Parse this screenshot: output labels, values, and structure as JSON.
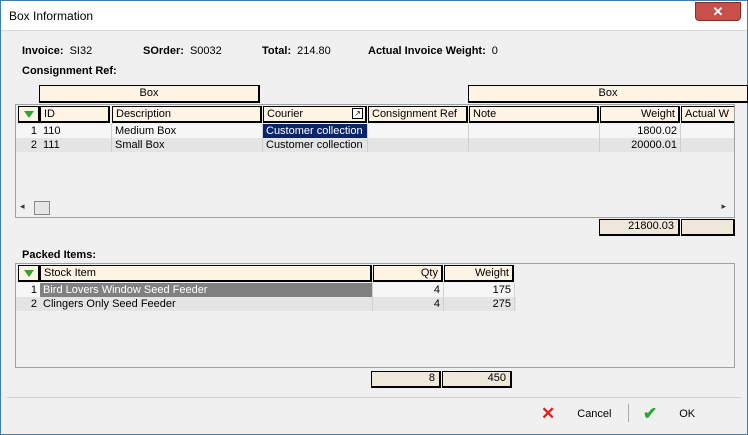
{
  "window": {
    "title": "Box Information"
  },
  "info": {
    "invoice_label": "Invoice:",
    "invoice_value": "SI32",
    "sorder_label": "SOrder:",
    "sorder_value": "S0032",
    "total_label": "Total:",
    "total_value": "214.80",
    "weight_label": "Actual Invoice Weight:",
    "weight_value": "0"
  },
  "consignment_label": "Consignment Ref:",
  "boxes": {
    "group_left": "Box",
    "group_right": "Box",
    "columns": {
      "id": "ID",
      "description": "Description",
      "courier": "Courier",
      "consignment_ref": "Consignment Ref",
      "note": "Note",
      "weight": "Weight",
      "actual_weight": "Actual W"
    },
    "rows": [
      {
        "num": "1",
        "id": "110",
        "description": "Medium Box",
        "courier": "Customer collection",
        "consignment_ref": "",
        "note": "",
        "weight": "1800.02"
      },
      {
        "num": "2",
        "id": "111",
        "description": "Small Box",
        "courier": "Customer collection",
        "consignment_ref": "",
        "note": "",
        "weight": "20000.01"
      }
    ],
    "total_weight": "21800.03"
  },
  "packed_label": "Packed Items:",
  "packed": {
    "columns": {
      "stock_item": "Stock Item",
      "qty": "Qty",
      "weight": "Weight"
    },
    "rows": [
      {
        "num": "1",
        "stock_item": "Bird Lovers Window Seed Feeder",
        "qty": "4",
        "weight": "175"
      },
      {
        "num": "2",
        "stock_item": "Clingers Only Seed Feeder",
        "qty": "4",
        "weight": "275"
      }
    ],
    "total_qty": "8",
    "total_weight": "450"
  },
  "buttons": {
    "cancel": "Cancel",
    "ok": "OK"
  },
  "colors": {
    "selection": "#0a246a",
    "filter_arrow": "#2aa832",
    "cancel_icon": "#d22",
    "ok_icon": "#2aa832"
  }
}
